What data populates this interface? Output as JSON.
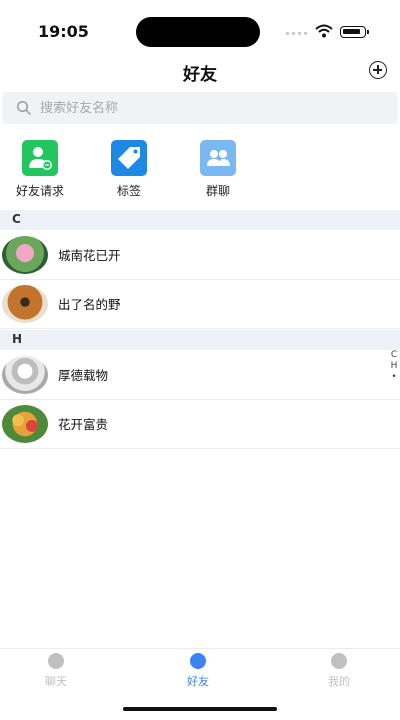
{
  "status_bar": {
    "time": "19:05"
  },
  "header": {
    "title": "好友"
  },
  "search": {
    "placeholder": "搜索好友名称"
  },
  "shortcuts": [
    {
      "label": "好友请求",
      "color": "#23c55e",
      "icon": "person-add-icon"
    },
    {
      "label": "标签",
      "color": "#1e88e5",
      "icon": "tag-icon"
    },
    {
      "label": "群聊",
      "color": "#7ab8f2",
      "icon": "group-icon"
    }
  ],
  "sections": [
    {
      "letter": "C",
      "contacts": [
        {
          "name": "城南花已开"
        },
        {
          "name": "出了名的野"
        }
      ]
    },
    {
      "letter": "H",
      "contacts": [
        {
          "name": "厚德载物"
        },
        {
          "name": "花开富贵"
        }
      ]
    }
  ],
  "index_bar": [
    "C",
    "H",
    "•"
  ],
  "tab_bar": {
    "active_color": "#3b82f6",
    "inactive_color": "#c0c0c0",
    "tabs": [
      {
        "label": "聊天",
        "active": false
      },
      {
        "label": "好友",
        "active": true
      },
      {
        "label": "我的",
        "active": false
      }
    ]
  }
}
